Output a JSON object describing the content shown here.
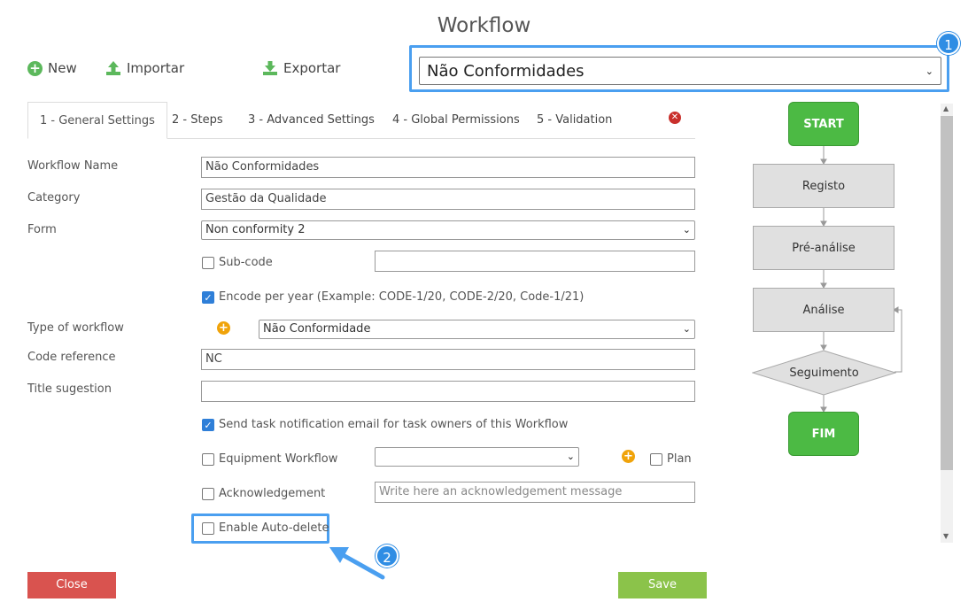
{
  "header": {
    "title": "Workflow"
  },
  "toolbar": {
    "new_label": "New",
    "import_label": "Importar",
    "export_label": "Exportar"
  },
  "workflow_select": {
    "value": "Não Conformidades"
  },
  "callouts": {
    "one": "1",
    "two": "2"
  },
  "tabs": [
    {
      "label": "1 - General Settings"
    },
    {
      "label": "2 - Steps"
    },
    {
      "label": "3 - Advanced Settings"
    },
    {
      "label": "4 - Global Permissions"
    },
    {
      "label": "5 - Validation"
    }
  ],
  "form": {
    "workflow_name_label": "Workflow Name",
    "workflow_name_value": "Não Conformidades",
    "category_label": "Category",
    "category_value": "Gestão da Qualidade",
    "form_label": "Form",
    "form_value": "Non conformity 2",
    "subcode_label": "Sub-code",
    "subcode_value": "",
    "encode_label": "Encode per year (Example: CODE-1/20, CODE-2/20, Code-1/21)",
    "type_label": "Type of workflow",
    "type_value": "Não Conformidade",
    "code_ref_label": "Code reference",
    "code_ref_value": "NC",
    "title_sugestion_label": "Title sugestion",
    "title_sugestion_value": "",
    "send_notification_label": "Send task notification email for task owners of this Workflow",
    "equipment_label": "Equipment Workflow",
    "equipment_value": "",
    "plan_label": "Plan",
    "ack_label": "Acknowledgement",
    "ack_placeholder": "Write here an acknowledgement message",
    "autodelete_label": "Enable Auto-delete"
  },
  "buttons": {
    "close": "Close",
    "save": "Save"
  },
  "flow": {
    "start": "START",
    "registo": "Registo",
    "pre_analise": "Pré-análise",
    "analise": "Análise",
    "seguimento": "Seguimento",
    "fim": "FIM"
  },
  "colors": {
    "accent": "#4a9ff0",
    "success": "#4cba44",
    "danger": "#d9534f",
    "save": "#8bc34a",
    "badge": "#2f8de4"
  }
}
